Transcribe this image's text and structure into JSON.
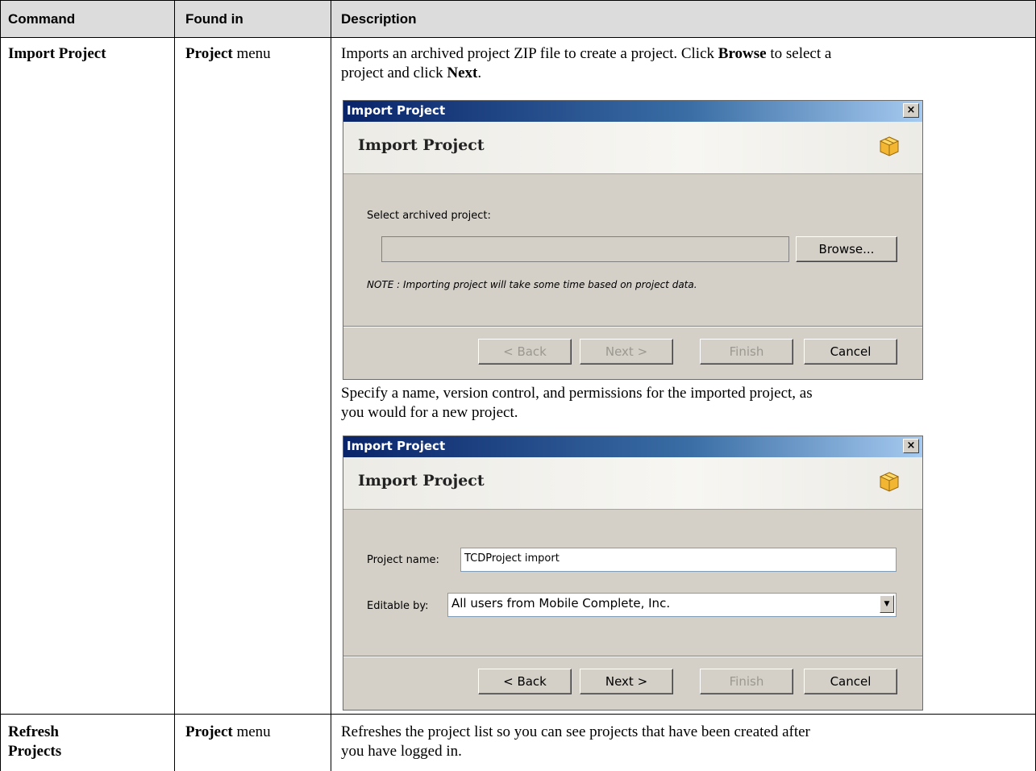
{
  "table": {
    "headers": [
      "Command",
      "Found in",
      "Description"
    ],
    "rows": [
      {
        "command": "Import Project",
        "found_in_bold": "Project",
        "found_in_rest": " menu",
        "desc1_a": "Imports an archived project ZIP file to create a project. Click ",
        "desc1_b": "Browse",
        "desc1_c": " to select a",
        "desc1_d": "project and click ",
        "desc1_e": "Next",
        "desc1_f": ".",
        "desc2_line1": "Specify a name, version control, and permissions for the imported project, as",
        "desc2_line2": "you would for a new project."
      },
      {
        "command_line1": "Refresh",
        "command_line2": "Projects",
        "found_in_bold": "Project",
        "found_in_rest": " menu",
        "desc_line1": "Refreshes the project list so you can see projects that have been created after",
        "desc_line2": "you have logged in."
      }
    ]
  },
  "dialog1": {
    "title": "Import Project",
    "close": "×",
    "banner_title": "Import Project",
    "select_label": "Select archived project:",
    "path_value": "",
    "browse_label": "Browse...",
    "note": "NOTE : Importing project will take some time based on project data.",
    "back_label": "< Back",
    "next_label": "Next >",
    "finish_label": "Finish",
    "cancel_label": "Cancel"
  },
  "dialog2": {
    "title": "Import Project",
    "close": "×",
    "banner_title": "Import Project",
    "name_label": "Project name:",
    "name_value": "TCDProject import",
    "editable_label": "Editable by:",
    "editable_value": "All users from Mobile Complete, Inc.",
    "back_label": "< Back",
    "next_label": "Next >",
    "finish_label": "Finish",
    "cancel_label": "Cancel"
  },
  "icons": {
    "package": "package-icon",
    "dropdown": "chevron-down-icon"
  }
}
